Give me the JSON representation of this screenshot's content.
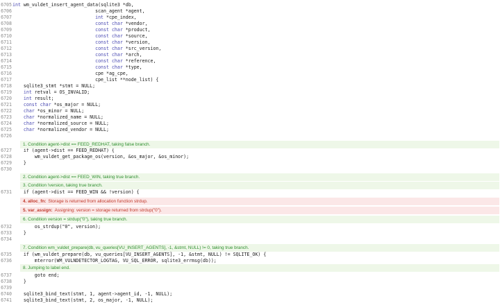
{
  "colors": {
    "keyword": "#4b4bb3",
    "event_green": "#2f8f2f",
    "event_green_bg": "#eef7e8",
    "event_red": "#c0392b",
    "event_red_bg": "#fbe7e7",
    "line_number": "#8a8a8a"
  },
  "lines": [
    {
      "n": "6705",
      "code": "int wm_vuldet_insert_agent_data(sqlite3 *db,"
    },
    {
      "n": "6706",
      "code": "                              scan_agent *agent,"
    },
    {
      "n": "6707",
      "code": "                              int *cpe_index,"
    },
    {
      "n": "6708",
      "code": "                              const char *vendor,"
    },
    {
      "n": "6709",
      "code": "                              const char *product,"
    },
    {
      "n": "6710",
      "code": "                              const char *source,"
    },
    {
      "n": "6711",
      "code": "                              const char *version,"
    },
    {
      "n": "6712",
      "code": "                              const char *src_version,"
    },
    {
      "n": "6713",
      "code": "                              const char *arch,"
    },
    {
      "n": "6714",
      "code": "                              const char *reference,"
    },
    {
      "n": "6715",
      "code": "                              const char *type,"
    },
    {
      "n": "6716",
      "code": "                              cpe *ag_cpe,"
    },
    {
      "n": "6717",
      "code": "                              cpe_list **node_list) {"
    },
    {
      "n": "6718",
      "code": "    sqlite3_stmt *stmt = NULL;"
    },
    {
      "n": "6719",
      "code": "    int retval = OS_INVALID;"
    },
    {
      "n": "6720",
      "code": "    int result;"
    },
    {
      "n": "6721",
      "code": "    const char *os_major = NULL;"
    },
    {
      "n": "6722",
      "code": "    char *os_minor = NULL;"
    },
    {
      "n": "6723",
      "code": "    char *normalized_name = NULL;"
    },
    {
      "n": "6724",
      "code": "    char *normalized_source = NULL;"
    },
    {
      "n": "6725",
      "code": "    char *normalized_vendor = NULL;"
    },
    {
      "n": "6726",
      "code": ""
    },
    {
      "n": "6727",
      "code": "    if (agent->dist == FEED_REDHAT) {"
    },
    {
      "n": "6728",
      "code": "        wm_vuldet_get_package_os(version, &os_major, &os_minor);"
    },
    {
      "n": "6729",
      "code": "    }"
    },
    {
      "n": "6730",
      "code": ""
    },
    {
      "n": "6731",
      "code": "    if (agent->dist == FEED_WIN && !version) {"
    },
    {
      "n": "6732",
      "code": "        os_strdup(\"0\", version);"
    },
    {
      "n": "6733",
      "code": "    }"
    },
    {
      "n": "6734",
      "code": ""
    },
    {
      "n": "6735",
      "code": "    if (wm_vuldet_prepare(db, vu_queries[VU_INSERT_AGENTS], -1, &stmt, NULL) != SQLITE_OK) {"
    },
    {
      "n": "6736",
      "code": "        mterror(WM_VULNDETECTOR_LOGTAG, VU_SQL_ERROR, sqlite3_errmsg(db));"
    },
    {
      "n": "6737",
      "code": "        goto end;"
    },
    {
      "n": "6738",
      "code": "    }"
    },
    {
      "n": "6739",
      "code": ""
    },
    {
      "n": "6740",
      "code": "    sqlite3_bind_text(stmt, 1, agent->agent_id, -1, NULL);"
    },
    {
      "n": "6741",
      "code": "    sqlite3_bind_text(stmt, 2, os_major, -1, NULL);"
    }
  ],
  "annotations": [
    {
      "tag": "",
      "text": "1. Condition agent->dist == FEED_REDHAT, taking false branch.",
      "kind": "green"
    },
    {
      "tag": "",
      "text": "2. Condition agent->dist == FEED_WIN, taking true branch.",
      "kind": "green"
    },
    {
      "tag": "",
      "text": "3. Condition !version, taking true branch.",
      "kind": "green"
    },
    {
      "tag": "4. alloc_fn:",
      "text": "Storage is returned from allocation function strdup.",
      "kind": "red"
    },
    {
      "tag": "5. var_assign:",
      "text": "Assigning: version = storage returned from strdup(\"0\").",
      "kind": "red"
    },
    {
      "tag": "",
      "text": "6. Condition version = strdup(\"0\"), taking true branch.",
      "kind": "green"
    },
    {
      "tag": "",
      "text": "7. Condition wm_vuldet_prepare(db, vu_queries[VU_INSERT_AGENTS], -1, &stmt, NULL) != 0, taking true branch.",
      "kind": "green"
    },
    {
      "tag": "",
      "text": "8. Jumping to label end.",
      "kind": "green"
    }
  ]
}
